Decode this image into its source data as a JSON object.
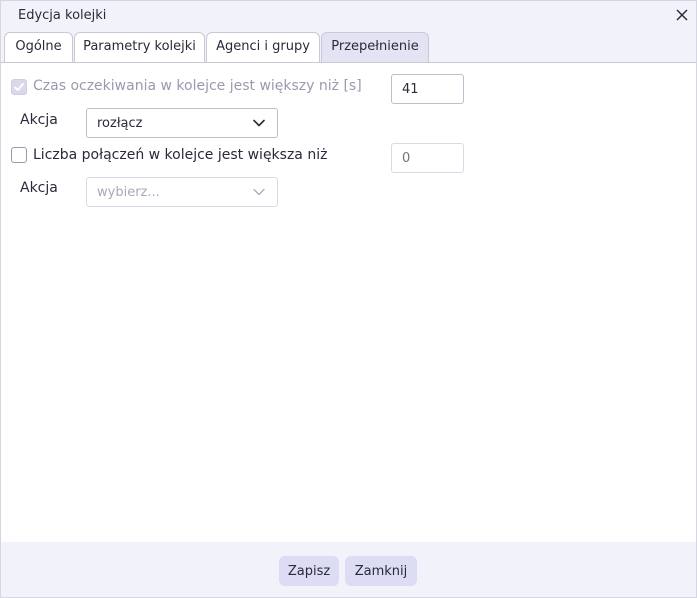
{
  "window": {
    "title": "Edycja kolejki"
  },
  "tabs": [
    {
      "label": "Ogólne"
    },
    {
      "label": "Parametry kolejki"
    },
    {
      "label": "Agenci i grupy"
    },
    {
      "label": "Przepełnienie"
    }
  ],
  "wait_rule": {
    "label": "Czas oczekiwania w kolejce jest większy niż [s]",
    "checked": true,
    "value": "41",
    "action_label": "Akcja",
    "action_value": "rozłącz"
  },
  "calls_rule": {
    "label": "Liczba połączeń w kolejce jest większa niż",
    "checked": false,
    "placeholder": "0",
    "action_label": "Akcja",
    "action_placeholder": "wybierz..."
  },
  "footer": {
    "save_label": "Zapisz",
    "close_label": "Zamknij"
  },
  "icons": {
    "close": "close-icon",
    "check": "check-icon",
    "chevron": "chevron-down-icon"
  }
}
